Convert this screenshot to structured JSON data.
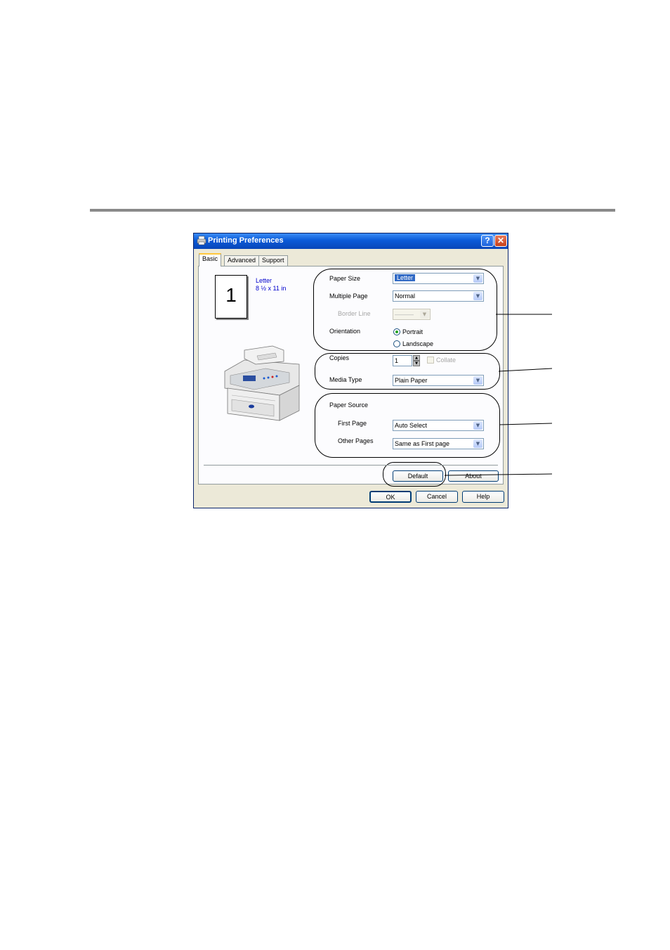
{
  "window": {
    "title": "Printing Preferences",
    "help_btn": "?",
    "close_btn": "✕"
  },
  "tabs": [
    {
      "label": "Basic",
      "active": true
    },
    {
      "label": "Advanced",
      "active": false
    },
    {
      "label": "Support",
      "active": false
    }
  ],
  "preview": {
    "page_number": "1",
    "paper_name": "Letter",
    "paper_dims": "8 ½ x 11 in"
  },
  "layout_group": {
    "paper_size_label": "Paper Size",
    "paper_size_value": "Letter",
    "multiple_page_label": "Multiple Page",
    "multiple_page_value": "Normal",
    "border_line_label": "Border Line",
    "border_line_value": "———",
    "orientation_label": "Orientation",
    "portrait_label": "Portrait",
    "landscape_label": "Landscape",
    "orientation_selected": "Portrait"
  },
  "copies_group": {
    "copies_label": "Copies",
    "copies_value": "1",
    "collate_label": "Collate",
    "media_type_label": "Media Type",
    "media_type_value": "Plain Paper"
  },
  "source_group": {
    "title": "Paper Source",
    "first_page_label": "First Page",
    "first_page_value": "Auto Select",
    "other_pages_label": "Other Pages",
    "other_pages_value": "Same as First page"
  },
  "buttons": {
    "default": "Default",
    "about": "About",
    "ok": "OK",
    "cancel": "Cancel",
    "help": "Help"
  },
  "colors": {
    "titlebar": "#0a5ad8",
    "dialog_bg": "#ece9d8",
    "tab_highlight": "#ffc73c",
    "selection": "#316ac5",
    "preview_text": "#0000cc"
  }
}
